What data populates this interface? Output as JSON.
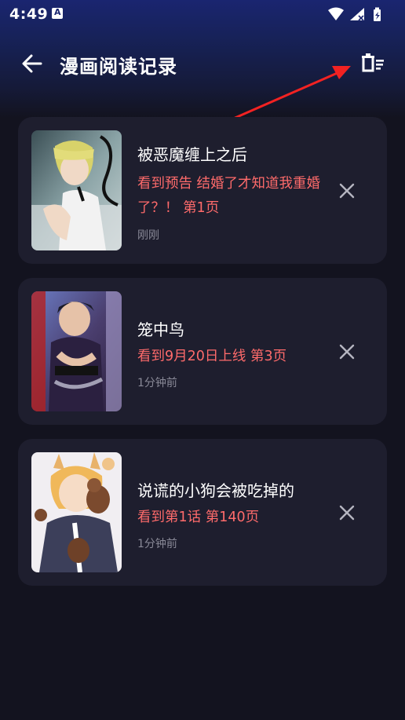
{
  "status_bar": {
    "time": "4:49",
    "notification_icon": "a-badge-icon",
    "icons": [
      "wifi-icon",
      "signal-icon",
      "battery-icon"
    ]
  },
  "app_bar": {
    "title": "漫画阅读记录",
    "back_icon": "arrow-left-icon",
    "clear_icon": "delete-list-icon"
  },
  "history": [
    {
      "title": "被恶魔缠上之后",
      "progress": "看到预告 结婚了才知道我重婚了？！ 第1页",
      "time": "刚刚"
    },
    {
      "title": "笼中鸟",
      "progress": "看到9月20日上线 第3页",
      "time": "1分钟前"
    },
    {
      "title": "说谎的小狗会被吃掉的",
      "progress": "看到第1话 第140页",
      "time": "1分钟前"
    }
  ],
  "colors": {
    "background": "#13131f",
    "card": "#1e1e2e",
    "accent_red": "#ff6b6b",
    "header": "#1a2570",
    "annotation_arrow": "#f22222"
  }
}
